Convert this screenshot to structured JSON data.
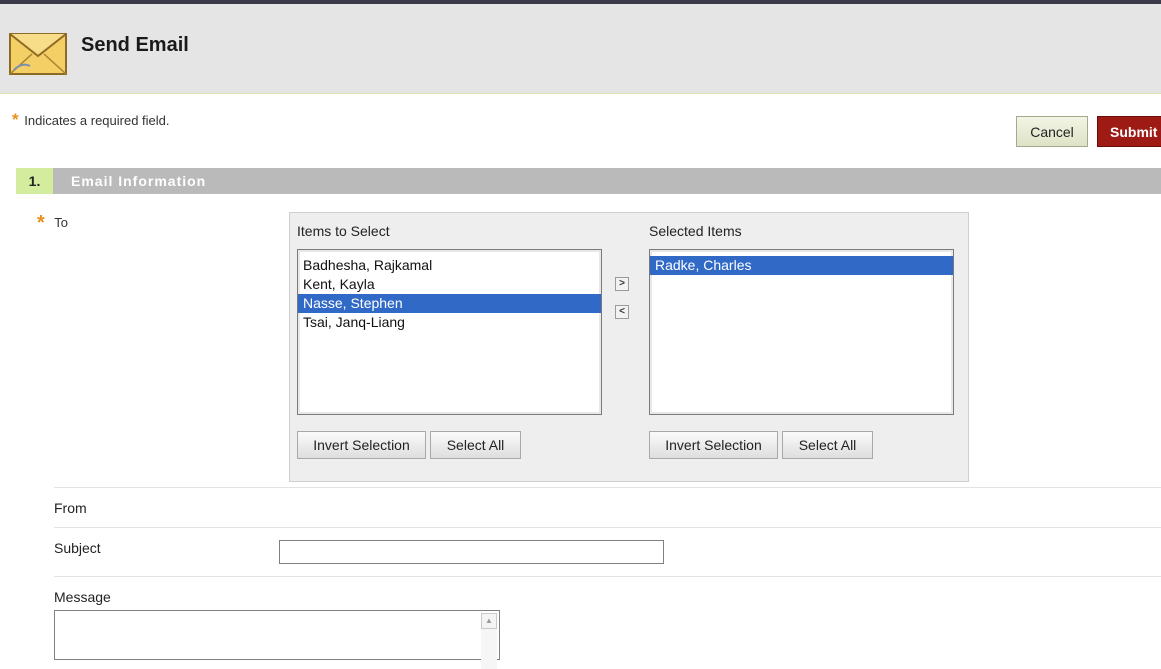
{
  "header": {
    "title": "Send Email",
    "icon": "envelope-icon"
  },
  "required_note": {
    "star": "*",
    "text": "Indicates a required field."
  },
  "actions": {
    "cancel_label": "Cancel",
    "submit_label": "Submit"
  },
  "section": {
    "number": "1.",
    "title": "Email Information"
  },
  "to_field": {
    "star": "*",
    "label": "To",
    "available": {
      "label": "Items to Select",
      "items": [
        "Badhesha, Rajkamal",
        "Kent, Kayla",
        "Nasse, Stephen",
        "Tsai, Janq-Liang"
      ],
      "selected_item": "Nasse, Stephen"
    },
    "chosen": {
      "label": "Selected Items",
      "items": [
        "Radke, Charles"
      ],
      "selected_item": "Radke, Charles"
    },
    "move_right_glyph": ">",
    "move_left_glyph": "<",
    "invert_label": "Invert Selection",
    "select_all_label": "Select All"
  },
  "from_field": {
    "label": "From"
  },
  "subject_field": {
    "label": "Subject",
    "value": ""
  },
  "message_field": {
    "label": "Message",
    "value": ""
  },
  "colors": {
    "submit": "#9e1a14",
    "section_number_bg": "#d4ec9e",
    "section_bar": "#bababa",
    "selection": "#3169c6",
    "required_star": "#e8901c"
  }
}
